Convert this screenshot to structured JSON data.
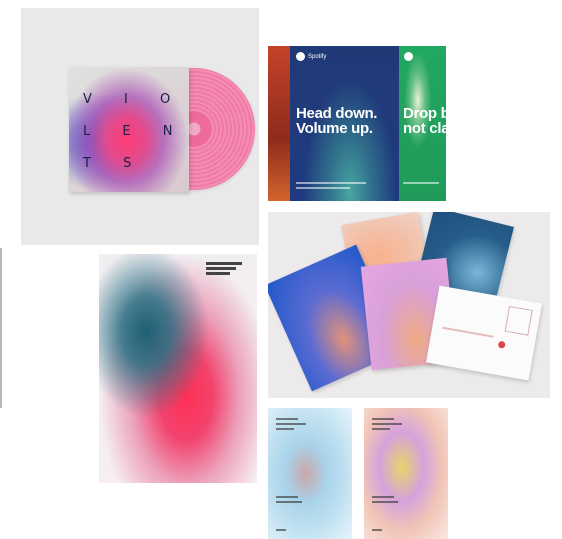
{
  "vinyl": {
    "sleeve_line_1": "V I O",
    "sleeve_line_2": "L E N",
    "sleeve_line_3": "T S"
  },
  "spotify_posters": {
    "brand": "Spotify",
    "headline_1": "Head down.\nVolume up.",
    "headline_2": "Drop beat\nnot classe"
  },
  "icons": {
    "logo": "spotify-logo-icon"
  }
}
